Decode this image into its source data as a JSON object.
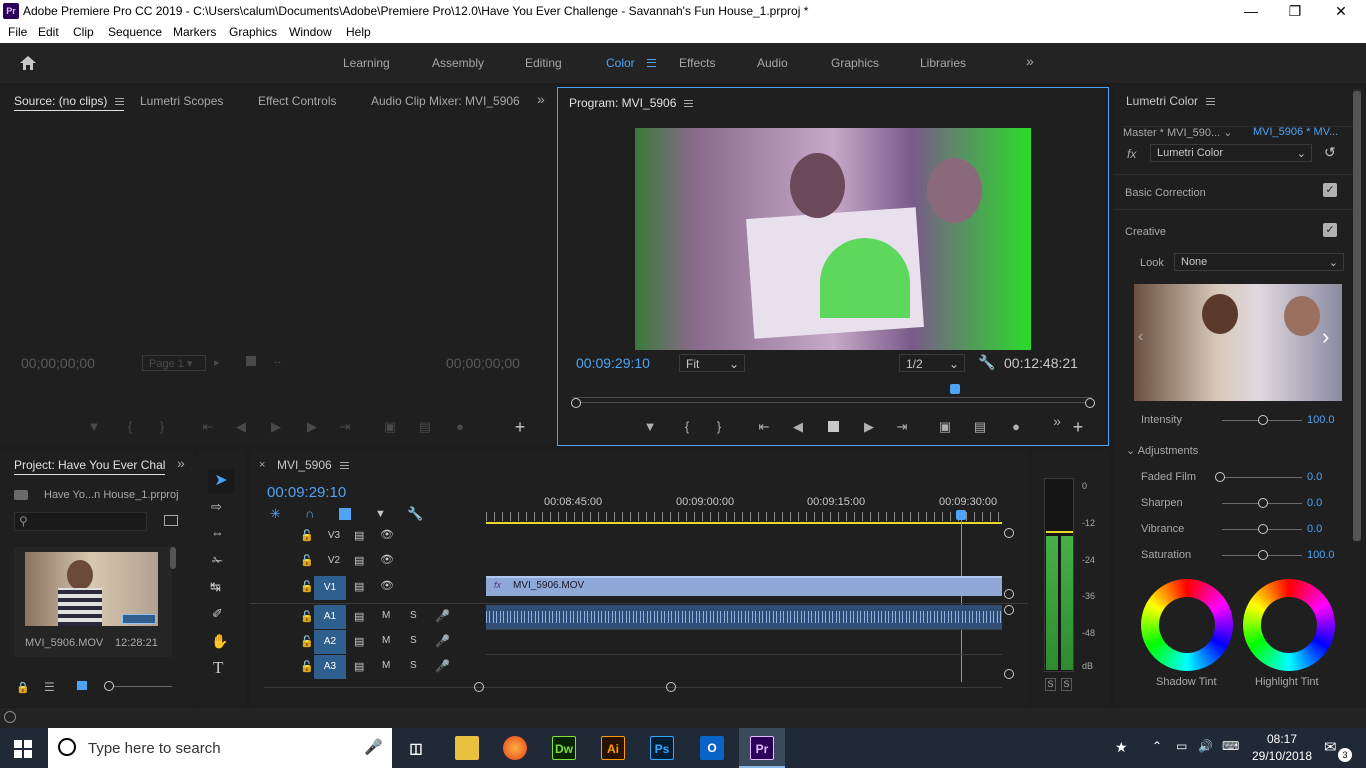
{
  "window": {
    "app_icon": "Pr",
    "title": "Adobe Premiere Pro CC 2019 - C:\\Users\\calum\\Documents\\Adobe\\Premiere Pro\\12.0\\Have You Ever Challenge - Savannah's Fun House_1.prproj *"
  },
  "menu": [
    "File",
    "Edit",
    "Clip",
    "Sequence",
    "Markers",
    "Graphics",
    "Window",
    "Help"
  ],
  "workspaces": {
    "items": [
      "Learning",
      "Assembly",
      "Editing",
      "Color",
      "Effects",
      "Audio",
      "Graphics",
      "Libraries"
    ],
    "active": "Color"
  },
  "source_panel": {
    "tabs": [
      "Source: (no clips)",
      "Lumetri Scopes",
      "Effect Controls",
      "Audio Clip Mixer: MVI_5906"
    ],
    "timecode_left": "00;00;00;00",
    "page": "Page 1",
    "timecode_right": "00;00;00;00"
  },
  "program_panel": {
    "title": "Program: MVI_5906",
    "timecode": "00:09:29:10",
    "fit": "Fit",
    "resolution": "1/2",
    "duration": "00:12:48:21",
    "playhead_fraction": 0.74
  },
  "project_panel": {
    "title": "Project: Have You Ever Chal",
    "file": "Have Yo...n House_1.prproj",
    "clip_name": "MVI_5906.MOV",
    "clip_duration": "12:28:21"
  },
  "timeline": {
    "sequence": "MVI_5906",
    "timecode": "00:09:29:10",
    "ruler": [
      "00:08:45:00",
      "00:09:00:00",
      "00:09:15:00",
      "00:09:30:00"
    ],
    "video_tracks": [
      "V3",
      "V2",
      "V1"
    ],
    "audio_tracks": [
      "A1",
      "A2",
      "A3"
    ],
    "clip_label": "MVI_5906.MOV",
    "mute": "M",
    "solo": "S"
  },
  "audio_meter": {
    "scale": [
      "0",
      "-12",
      "-24",
      "-36",
      "-48",
      "dB"
    ],
    "solo_labels": [
      "S",
      "S"
    ]
  },
  "lumetri": {
    "title": "Lumetri Color",
    "master": "Master * MVI_590...",
    "clip": "MVI_5906 * MV...",
    "effect": "Lumetri Color",
    "fx_label": "fx",
    "basic_correction": "Basic Correction",
    "creative": "Creative",
    "look_label": "Look",
    "look_value": "None",
    "intensity_label": "Intensity",
    "intensity_value": "100.0",
    "adjustments": "Adjustments",
    "faded_film_label": "Faded Film",
    "faded_film_value": "0.0",
    "sharpen_label": "Sharpen",
    "sharpen_value": "0.0",
    "vibrance_label": "Vibrance",
    "vibrance_value": "0.0",
    "saturation_label": "Saturation",
    "saturation_value": "100.0",
    "shadow_tint": "Shadow Tint",
    "highlight_tint": "Highlight Tint"
  },
  "taskbar": {
    "search_placeholder": "Type here to search",
    "time": "08:17",
    "date": "29/10/2018",
    "notifications": "3",
    "apps": [
      "Dw",
      "Ai",
      "Ps",
      "Pr"
    ]
  },
  "colors": {
    "accent": "#4fa3f4",
    "track_selected": "#2f5f8f",
    "clip": "#8fa8d8"
  }
}
